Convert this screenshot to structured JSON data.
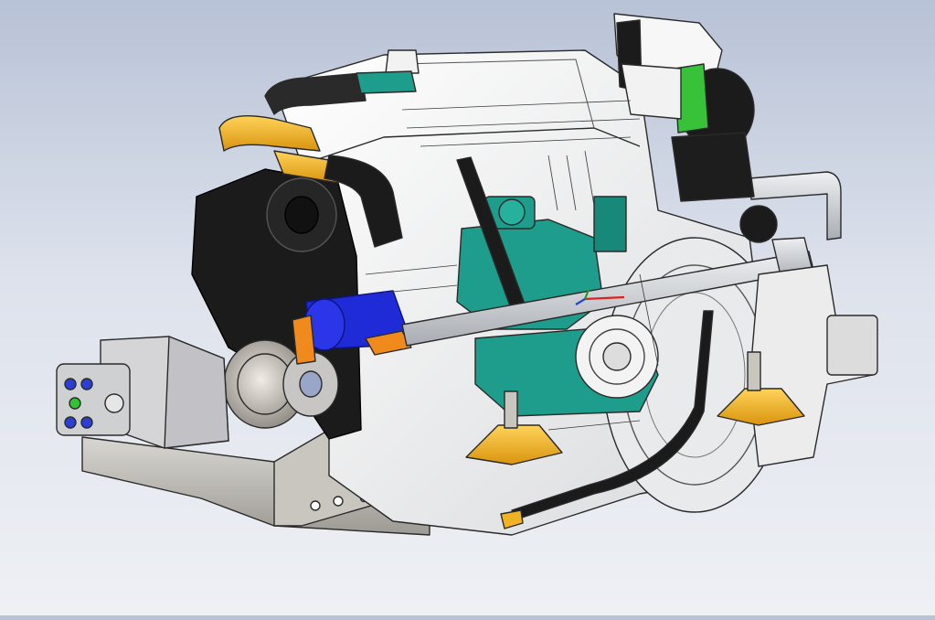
{
  "viewport": {
    "background_top": "#b8c2d6",
    "background_bottom": "#eef0f4",
    "model_colors": {
      "block": "#f4f4f4",
      "block_outline": "#2a2a2a",
      "teal_parts": "#1e9c8c",
      "black_parts": "#1b1b1b",
      "yellow_hoses": "#f0b323",
      "orange_fittings": "#f08a1c",
      "blue_pump": "#1f2bd6",
      "green_band": "#37c23a",
      "grey_bracket": "#b9b6b0",
      "pipe": "#cfd3d8"
    },
    "icons": [
      "engine-model",
      "coordinate-triad-icon"
    ]
  },
  "triad": {
    "x_color": "#e02020",
    "y_color": "#20a020",
    "z_color": "#2040e0"
  }
}
